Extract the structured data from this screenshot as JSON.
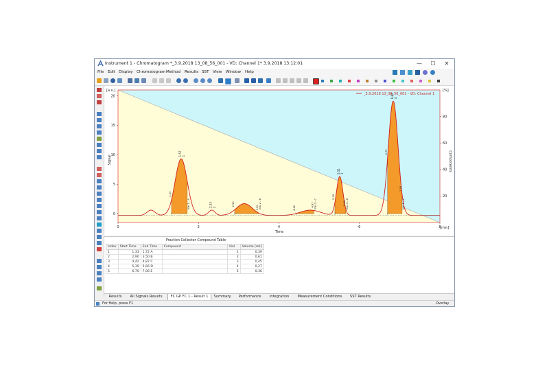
{
  "window": {
    "title": "Instrument 1 - Chromatogram *_3.9.2018 13_08_56_001 - VD: Channel 1* 3.9.2018 13:12:01",
    "controls": {
      "minimize": "—",
      "maximize": "☐",
      "close": "✕"
    }
  },
  "menu": [
    "File",
    "Edit",
    "Display",
    "Chromatogram",
    "Method",
    "Results",
    "SST",
    "View",
    "Window",
    "Help"
  ],
  "toolbar_swatches": [
    "#2a7ab8",
    "#3aa845",
    "#20b0b0",
    "#e04040",
    "#c040c0",
    "#c08030",
    "#8e8e8e",
    "#5050d0",
    "#40c040",
    "#40c8c8",
    "#e06060",
    "#d060d0",
    "#e0c040",
    "#404040"
  ],
  "chart": {
    "y_unit_label": "[a.u.]",
    "y_title": "Signal",
    "y2_unit_label": "[%]",
    "y2_title": "Components",
    "x_title": "Time",
    "x_unit_label": "[min]",
    "legend": "_3.9.2018 13_08_56_001 - VD: Channel 1",
    "signal_color": "#d02020"
  },
  "chart_data": {
    "type": "line",
    "xlabel": "Time",
    "ylabel": "Signal",
    "xlim": [
      0,
      8
    ],
    "ylim": [
      -1.5,
      21
    ],
    "y2lim": [
      0,
      100
    ],
    "x_ticks": [
      0,
      2,
      4,
      6,
      8
    ],
    "y_ticks": [
      0,
      5,
      10,
      15,
      20
    ],
    "y2_ticks": [
      20,
      40,
      60,
      80
    ],
    "grid": false,
    "legend_position": "top-right",
    "gradient": {
      "x": [
        0,
        8
      ],
      "y2": [
        100,
        0
      ]
    },
    "series": [
      {
        "name": "_3.9.2018 13_08_56_001 - VD: Channel 1",
        "peaks": [
          {
            "rt": 0.82,
            "height": 0.9,
            "width": 0.1
          },
          {
            "rt": 1.57,
            "height": 9.6,
            "width": 0.15
          },
          {
            "rt": 2.33,
            "height": 0.9,
            "width": 0.08
          },
          {
            "rt": 3.14,
            "height": 2.0,
            "width": 0.2
          },
          {
            "rt": 4.78,
            "height": 0.9,
            "width": 0.25
          },
          {
            "rt": 5.51,
            "height": 6.6,
            "width": 0.08
          },
          {
            "rt": 6.84,
            "height": 19.4,
            "width": 0.12
          }
        ],
        "baseline": -0.3
      }
    ],
    "fractions": [
      {
        "start": 1.33,
        "end": 1.72,
        "label": "Vial 1 - A"
      },
      {
        "start": 2.9,
        "end": 3.5,
        "label": "Vial 2 - B"
      },
      {
        "start": 4.42,
        "end": 4.87,
        "label": "Vial 3 - C"
      },
      {
        "start": 5.39,
        "end": 5.66,
        "label": "Vial 4 - D"
      },
      {
        "start": 6.7,
        "end": 7.06,
        "label": "Vial 5 - E"
      }
    ],
    "peak_labels": [
      {
        "rt": 1.57,
        "text": "1.57",
        "number": "1"
      },
      {
        "rt": 2.33,
        "text": "2.33",
        "number": "2"
      },
      {
        "rt": 5.51,
        "text": "5.51",
        "number": "3"
      },
      {
        "rt": 6.84,
        "text": "6.84",
        "number": "4"
      }
    ],
    "fraction_time_labels": [
      {
        "t": 1.33,
        "text": "1.33"
      },
      {
        "t": 2.9,
        "text": "2.90"
      },
      {
        "t": 4.42,
        "text": "4.42"
      },
      {
        "t": 4.87,
        "text": "4.87"
      },
      {
        "t": 5.39,
        "text": "5.39"
      },
      {
        "t": 6.7,
        "text": "6.70"
      },
      {
        "t": 3.5,
        "text": "3.50"
      },
      {
        "t": 5.66,
        "text": "5.66"
      },
      {
        "t": 7.06,
        "text": "7.06"
      }
    ]
  },
  "fraction_table": {
    "caption": "Fraction Collector Compound Table",
    "headers": [
      "Index",
      "Start Time",
      "End Time",
      "Compound",
      "Vial",
      "Volume [mL]"
    ],
    "rows": [
      [
        "1",
        "1,33",
        "1,72",
        "A",
        "1",
        "0,39"
      ],
      [
        "2",
        "2,90",
        "3,50",
        "B",
        "2",
        "0,61"
      ],
      [
        "3",
        "4,42",
        "4,87",
        "C",
        "3",
        "0,45"
      ],
      [
        "4",
        "5,39",
        "5,66",
        "D",
        "4",
        "0,27"
      ],
      [
        "5",
        "6,70",
        "7,06",
        "E",
        "5",
        "0,36"
      ]
    ]
  },
  "tabs": [
    "Results",
    "All Signals Results",
    "FC GP FC 1 - Result 1",
    "Summary",
    "Performance",
    "Integration",
    "Measurement Conditions",
    "SST Results"
  ],
  "active_tab": 2,
  "status": {
    "help": "For Help, press F1",
    "mode": "Overlay"
  }
}
